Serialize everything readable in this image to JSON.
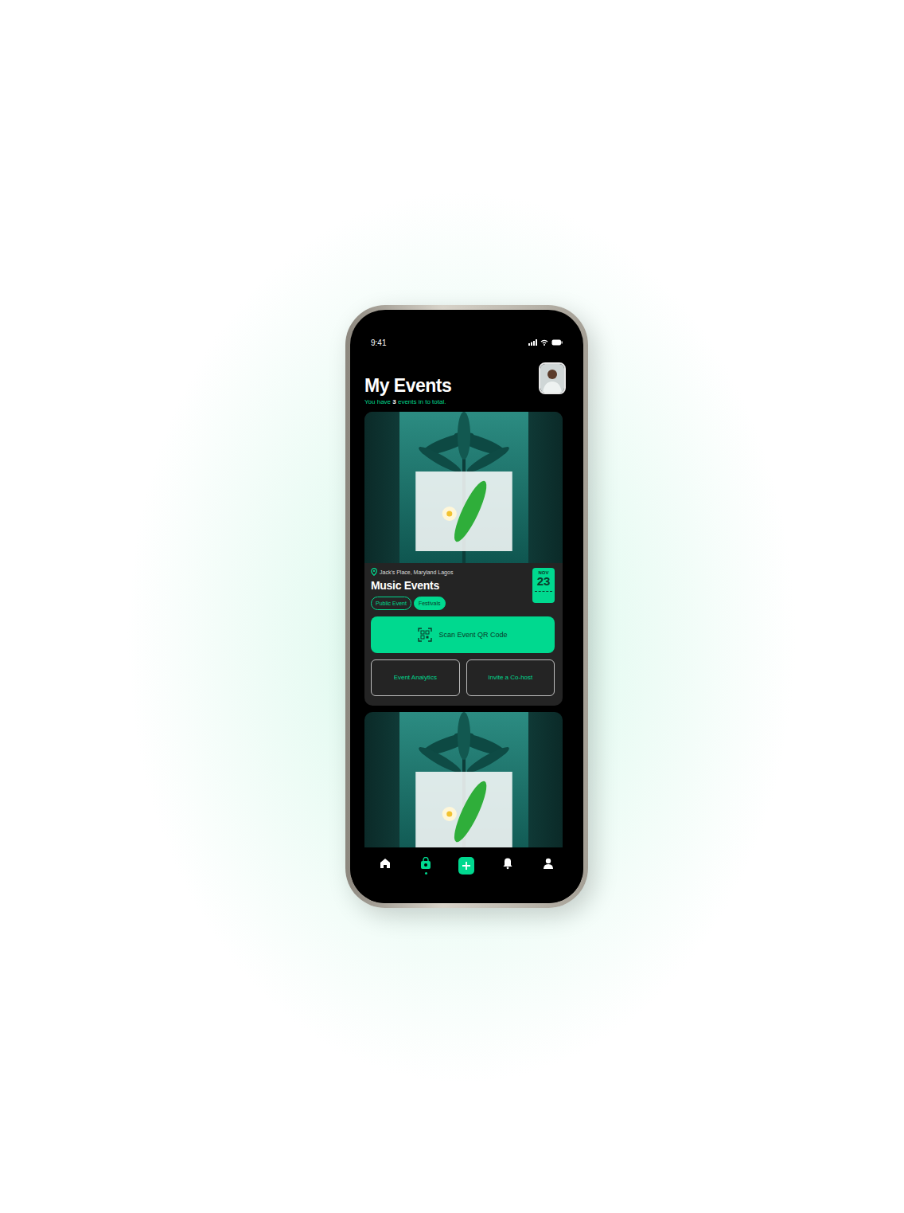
{
  "status_bar": {
    "time": "9:41"
  },
  "header": {
    "title": "My Events",
    "subtitle_prefix": "You have",
    "count": "3",
    "subtitle_suffix": "events in to total."
  },
  "events": [
    {
      "expanded": true,
      "location": "Jack's Place, Maryland Lagos",
      "title": "Music Events",
      "tags": [
        {
          "label": "Public Event",
          "selected": false
        },
        {
          "label": "Festivals",
          "selected": true
        }
      ],
      "date": {
        "month": "NOV",
        "day": "23"
      },
      "primary_action": "Scan Event QR Code",
      "secondary_actions": [
        "Event Analytics",
        "Invite a Co-host"
      ]
    },
    {
      "expanded": false
    }
  ],
  "nav": [
    {
      "kind": "home",
      "selected": false
    },
    {
      "kind": "events",
      "selected": true
    },
    {
      "kind": "add",
      "selected": false
    },
    {
      "kind": "bell",
      "selected": false
    },
    {
      "kind": "profile",
      "selected": false
    }
  ]
}
